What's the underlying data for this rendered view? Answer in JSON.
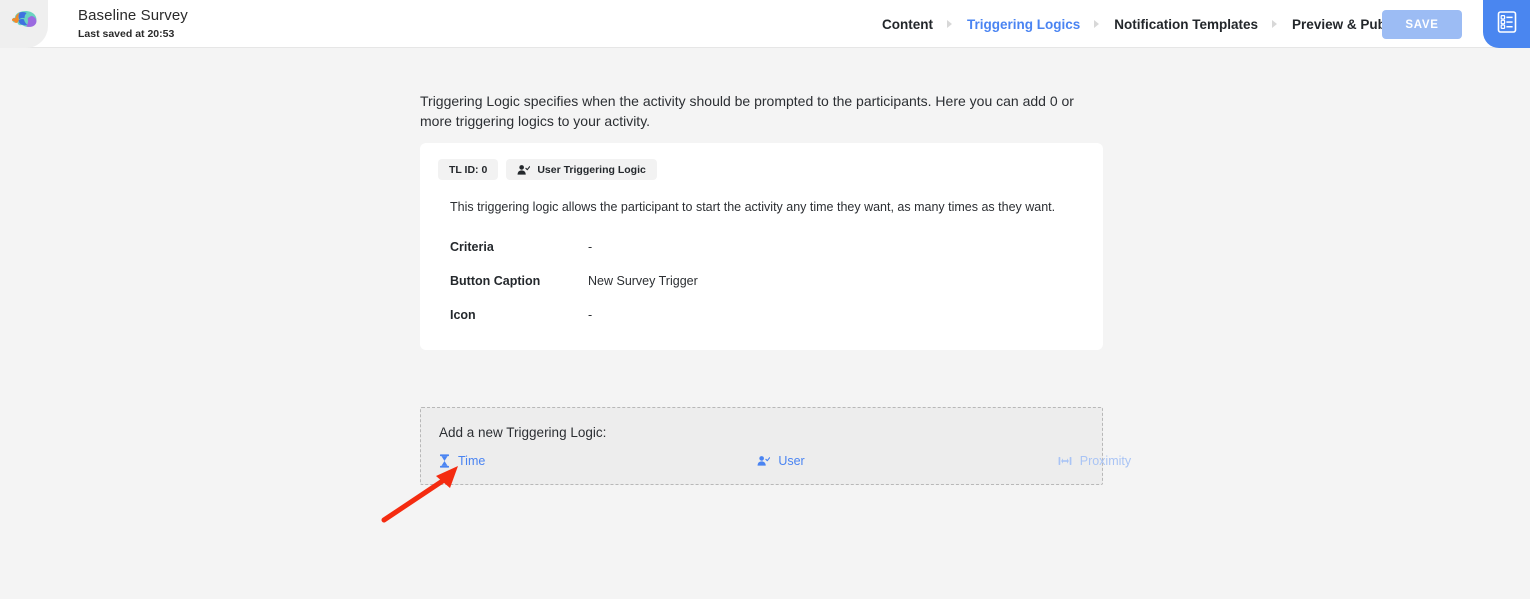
{
  "header": {
    "logo_icon": "brain-puzzle-logo",
    "title": "Baseline Survey",
    "subtitle": "Last saved at 20:53",
    "nav": [
      {
        "label": "Content",
        "active": false
      },
      {
        "label": "Triggering Logics",
        "active": true
      },
      {
        "label": "Notification Templates",
        "active": false
      },
      {
        "label": "Preview & Publish",
        "active": false
      }
    ],
    "save_label": "SAVE",
    "side_tab_icon": "survey-form-icon"
  },
  "main": {
    "intro": "Triggering Logic specifies when the activity should be prompted to the participants. Here you can add 0 or more triggering logics to your activity.",
    "card": {
      "id_chip": "TL ID: 0",
      "type_chip": "User Triggering Logic",
      "type_chip_icon": "person-check-icon",
      "description": "This triggering logic allows the participant to start the activity any time they want, as many times as they want.",
      "properties": [
        {
          "label": "Criteria",
          "value": "-"
        },
        {
          "label": "Button Caption",
          "value": "New Survey Trigger"
        },
        {
          "label": "Icon",
          "value": "-"
        }
      ]
    },
    "add_panel": {
      "title": "Add a new Triggering Logic:",
      "options": [
        {
          "label": "Time",
          "icon": "hourglass-icon",
          "disabled": false
        },
        {
          "label": "User",
          "icon": "person-check-icon",
          "disabled": false
        },
        {
          "label": "Proximity",
          "icon": "proximity-width-icon",
          "disabled": true
        }
      ]
    }
  },
  "colors": {
    "accent": "#4a84f2",
    "accent_disabled": "#a9c4f5",
    "save_button": "#9cbcf4",
    "side_tab": "#4a86f0",
    "page_background": "#f4f4f4",
    "panel_background": "#ededed",
    "annotation_arrow": "#f42b10"
  }
}
